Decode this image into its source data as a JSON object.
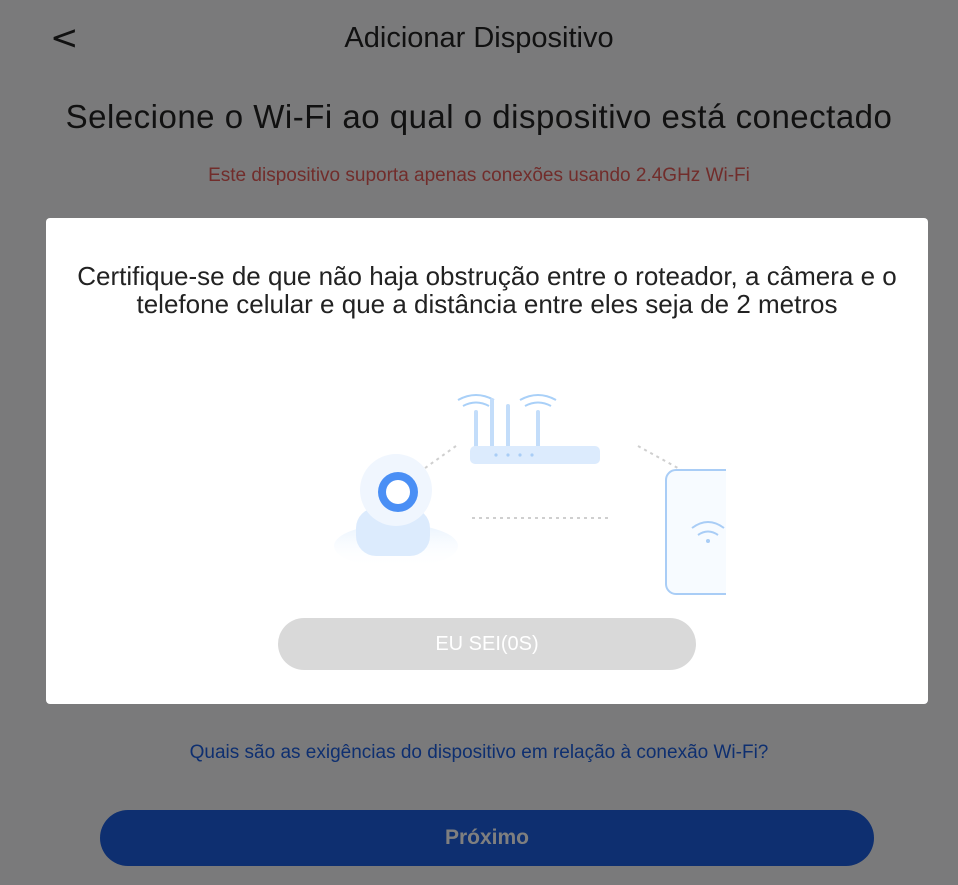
{
  "header": {
    "back_icon": "chevron-left-icon",
    "back_glyph": "<",
    "title": "Adicionar Dispositivo"
  },
  "main": {
    "heading": "Selecione o Wi-Fi ao qual o dispositivo está conectado",
    "warning": "Este dispositivo suporta apenas conexões usando 2.4GHz Wi-Fi",
    "requirements_link": "Quais são as exigências do dispositivo em relação à conexão Wi-Fi?",
    "next_label": "Próximo"
  },
  "modal": {
    "message": "Certifique-se de que não haja obstrução entre o roteador, a câmera e o telefone celular e que a distância entre eles seja de 2 metros",
    "illustration_icons": [
      "router-icon",
      "camera-icon",
      "phone-icon"
    ],
    "confirm_label": "EU SEI(0S)"
  },
  "colors": {
    "accent": "#1c5fe0",
    "warning": "#e25a57",
    "disabled_button": "#d9d9d9",
    "illustration": "#8fc0f5"
  }
}
